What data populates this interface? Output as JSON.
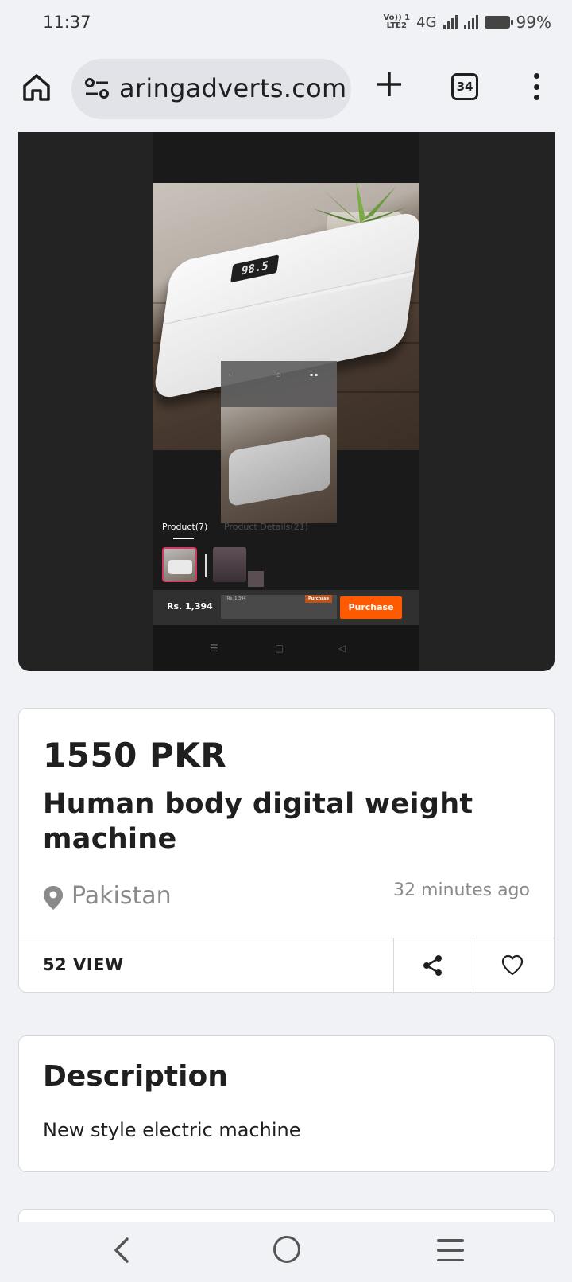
{
  "status_bar": {
    "time": "11:37",
    "volte": "Vo)) 1",
    "lte": "LTE2",
    "network": "4G",
    "battery": "99%"
  },
  "browser": {
    "url": "aringadverts.com",
    "tab_count": "34",
    "icons": [
      "home-icon",
      "site-settings-icon",
      "new-tab-icon",
      "tab-switcher-icon",
      "more-menu-icon"
    ]
  },
  "media": {
    "lcd_reading": "98.5",
    "tabs": [
      "Product(7)",
      "Product Details(21)"
    ],
    "price": "Rs. 1,394",
    "mini_price": "Rs. 1,394",
    "mini_button": "Purchase",
    "buy_button": "Purchase"
  },
  "product": {
    "price": "1550 PKR",
    "title": "Human body digital weight machine",
    "location": "Pakistan",
    "time_ago": "32 minutes ago",
    "views": "52 VIEW"
  },
  "description": {
    "heading": "Description",
    "text": "New style electric machine"
  },
  "colors": {
    "accent": "#ff5a00",
    "thumb_border": "#d23a64",
    "page_bg": "#f1f2f6"
  }
}
